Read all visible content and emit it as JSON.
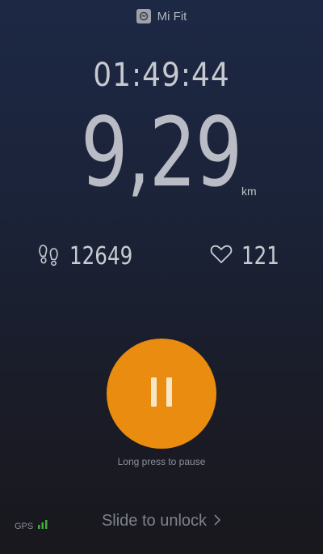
{
  "header": {
    "app_title": "Mi Fit",
    "app_icon": "mi-fit-logo-icon"
  },
  "workout": {
    "duration": "01:49:44",
    "distance": "9,29",
    "distance_unit": "km",
    "steps": "12649",
    "steps_icon": "footprints-icon",
    "heart_rate": "121",
    "heart_icon": "heart-icon"
  },
  "controls": {
    "pause_icon": "pause-icon",
    "pause_hint": "Long press to pause",
    "accent_color": "#e98c10"
  },
  "footer": {
    "gps_label": "GPS",
    "gps_signal_icon": "signal-bars-icon",
    "gps_signal_color": "#3fae3a",
    "unlock_label": "Slide to unlock",
    "unlock_icon": "chevron-right-icon"
  }
}
